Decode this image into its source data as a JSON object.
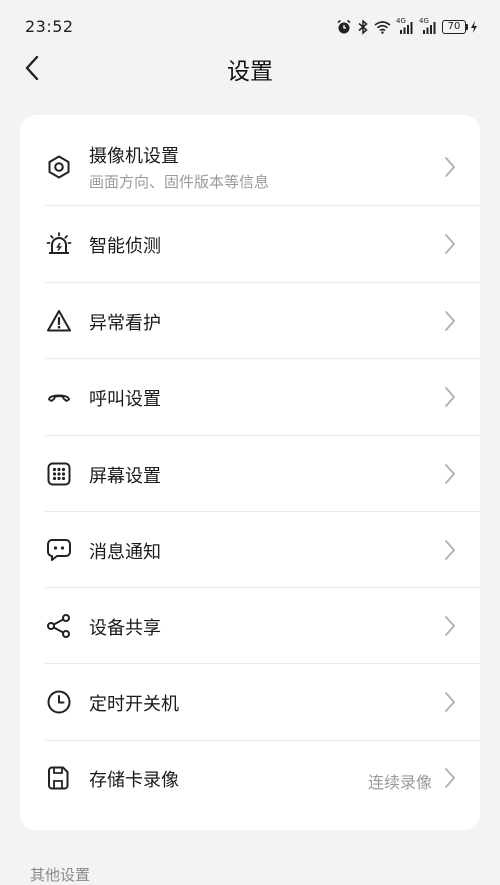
{
  "status_bar": {
    "time": "23:52",
    "signal_1_label": "4G",
    "signal_2_label": "4G",
    "battery": "70"
  },
  "header": {
    "title": "设置"
  },
  "settings": [
    {
      "label": "摄像机设置",
      "sublabel": "画面方向、固件版本等信息",
      "value": "",
      "icon": "hexagon-settings-icon"
    },
    {
      "label": "智能侦测",
      "sublabel": "",
      "value": "",
      "icon": "alarm-light-icon"
    },
    {
      "label": "异常看护",
      "sublabel": "",
      "value": "",
      "icon": "warning-triangle-icon"
    },
    {
      "label": "呼叫设置",
      "sublabel": "",
      "value": "",
      "icon": "phone-hangup-icon"
    },
    {
      "label": "屏幕设置",
      "sublabel": "",
      "value": "",
      "icon": "grid-icon"
    },
    {
      "label": "消息通知",
      "sublabel": "",
      "value": "",
      "icon": "chat-bubble-icon"
    },
    {
      "label": "设备共享",
      "sublabel": "",
      "value": "",
      "icon": "share-icon"
    },
    {
      "label": "定时开关机",
      "sublabel": "",
      "value": "",
      "icon": "clock-icon"
    },
    {
      "label": "存储卡录像",
      "sublabel": "",
      "value": "连续录像",
      "icon": "sd-card-icon"
    }
  ],
  "other_section": {
    "label": "其他设置"
  },
  "colors": {
    "background": "#f3f3f3",
    "card": "#ffffff",
    "secondary_text": "#9a9a9a"
  }
}
